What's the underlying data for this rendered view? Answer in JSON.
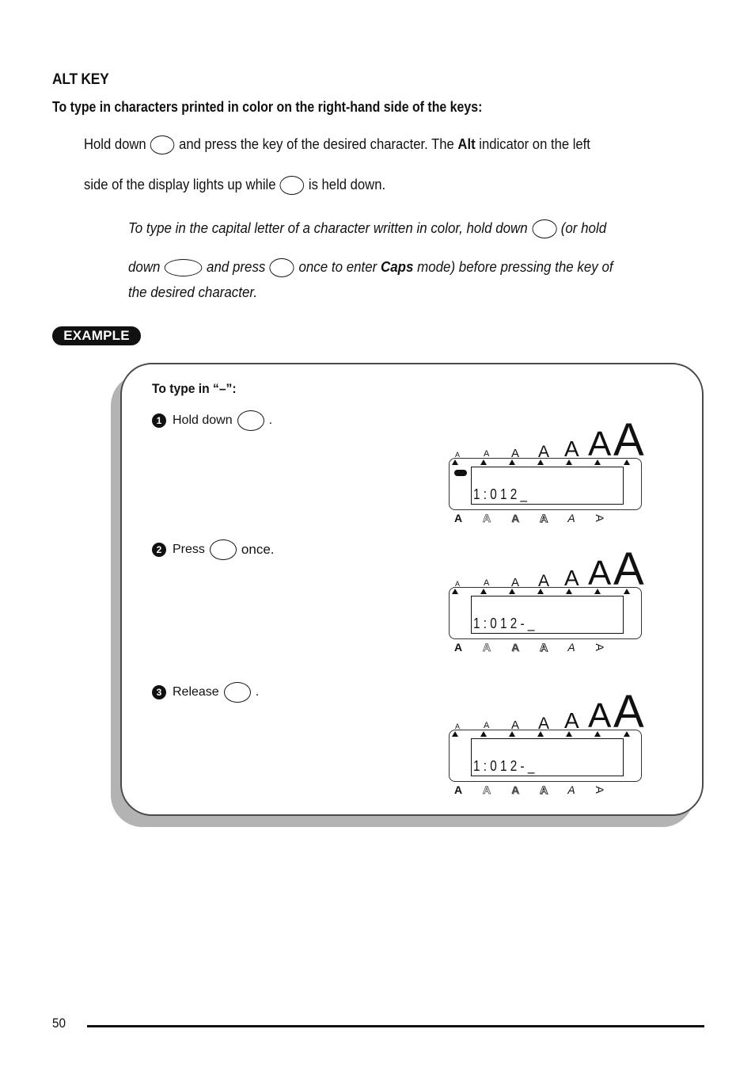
{
  "section": {
    "title": "ALT KEY",
    "subtitle": "To type in characters printed in color on the right-hand side of the keys:"
  },
  "body": {
    "line1_a": "Hold down",
    "line1_b": "and press the key of the desired character. The",
    "line1_bold": "Alt",
    "line1_c": "indicator on the left",
    "line2_a": "side of the display lights up while",
    "line2_b": "is held down."
  },
  "note": {
    "line1_a": "To type in the capital letter of a character written in color, hold down",
    "line1_b": "(or hold",
    "line2_a": "down",
    "line2_b": "and press",
    "line2_c": "once to enter",
    "line2_bold": "Caps",
    "line2_d": "mode) before pressing the key of",
    "line3": "the desired character."
  },
  "example": {
    "badge": "EXAMPLE",
    "heading": "To type in “–”:",
    "steps": [
      {
        "number": "1",
        "text_before": "Hold down",
        "text_after": ".",
        "display": {
          "alt_indicator": true,
          "text": "1:012_"
        }
      },
      {
        "number": "2",
        "text_before": "Press",
        "text_after": "once.",
        "display": {
          "alt_indicator": false,
          "text": "1:012-_"
        }
      },
      {
        "number": "3",
        "text_before": "Release",
        "text_after": ".",
        "display": {
          "alt_indicator": false,
          "text": "1:012-_"
        }
      }
    ],
    "size_indicator_glyph": "A",
    "style_indicator_glyph": "A"
  },
  "footer": {
    "page_number": "50"
  }
}
